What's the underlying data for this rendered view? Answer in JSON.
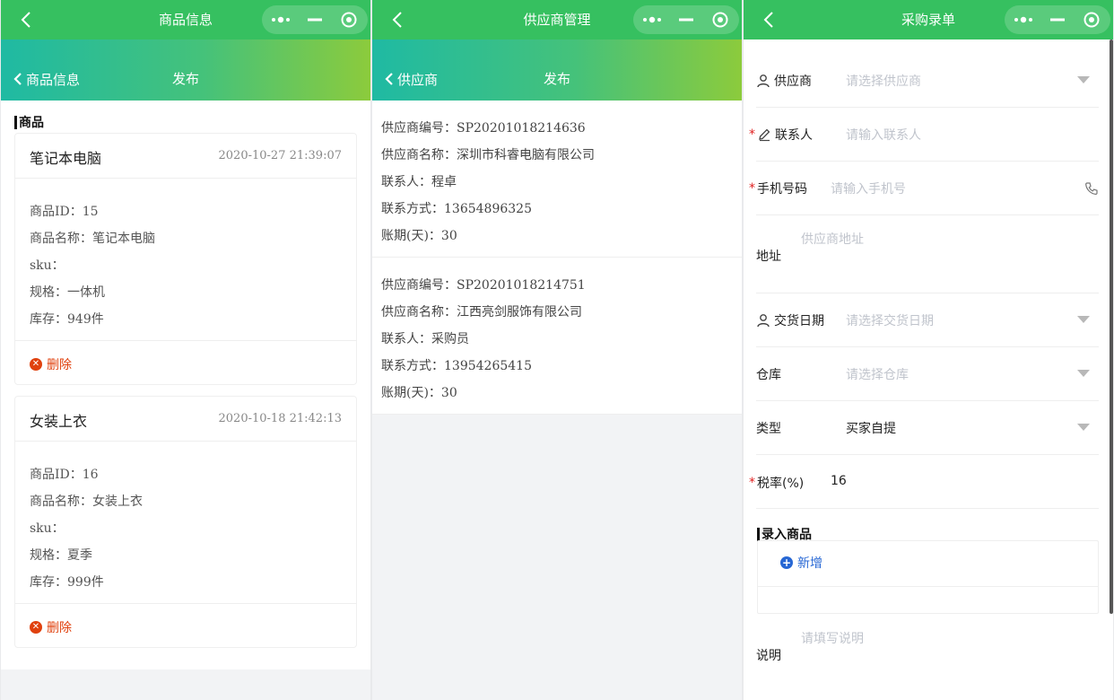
{
  "screen1": {
    "title": "商品信息",
    "back_label": "商品信息",
    "publish_label": "发布",
    "section_title": "商品",
    "products": [
      {
        "name": "笔记本电脑",
        "time": "2020-10-27 21:39:07",
        "rows": [
          "商品ID：15",
          "商品名称：笔记本电脑",
          "sku：",
          "规格：一体机",
          "库存：949件"
        ],
        "delete_label": "删除"
      },
      {
        "name": "女装上衣",
        "time": "2020-10-18 21:42:13",
        "rows": [
          "商品ID：16",
          "商品名称：女装上衣",
          "sku：",
          "规格：夏季",
          "库存：999件"
        ],
        "delete_label": "删除"
      }
    ]
  },
  "screen2": {
    "title": "供应商管理",
    "back_label": "供应商",
    "publish_label": "发布",
    "suppliers": [
      {
        "rows": [
          "供应商编号：SP20201018214636",
          "供应商名称：深圳市科睿电脑有限公司",
          "联系人：程卓",
          "联系方式：13654896325",
          "账期(天)：30"
        ]
      },
      {
        "rows": [
          "供应商编号：SP20201018214751",
          "供应商名称：江西亮剑服饰有限公司",
          "联系人：采购员",
          "联系方式：13954265415",
          "账期(天)：30"
        ]
      }
    ]
  },
  "screen3": {
    "title": "采购录单",
    "supplier": {
      "label": "供应商",
      "placeholder": "请选择供应商"
    },
    "contact": {
      "label": "联系人",
      "placeholder": "请输入联系人"
    },
    "phone": {
      "label": "手机号码",
      "placeholder": "请输入手机号"
    },
    "address": {
      "label": "地址",
      "placeholder": "供应商地址"
    },
    "delivery": {
      "label": "交货日期",
      "placeholder": "请选择交货日期"
    },
    "warehouse": {
      "label": "仓库",
      "placeholder": "请选择仓库"
    },
    "type": {
      "label": "类型",
      "value": "买家自提"
    },
    "tax": {
      "label": "税率(%)",
      "value": "16"
    },
    "goods_section": "录入商品",
    "add_label": "新增",
    "note": {
      "label": "说明",
      "placeholder": "请填写说明"
    },
    "required_mark": "*"
  },
  "colors": {
    "titlebar": "#36c060",
    "gradient_start": "#1fbaa3",
    "gradient_end": "#8ccb3c",
    "delete_red": "#e0410e",
    "link_blue": "#2767d4",
    "required_red": "#e02020"
  },
  "icons": {
    "back": "chevron-left-icon",
    "more": "more-dots-icon",
    "minimize": "minus-icon",
    "close": "target-circle-icon",
    "user": "user-icon",
    "edit": "pencil-icon",
    "phone": "phone-icon",
    "dropdown": "triangle-down-icon",
    "delete": "close-circle-icon",
    "add": "plus-circle-icon"
  }
}
